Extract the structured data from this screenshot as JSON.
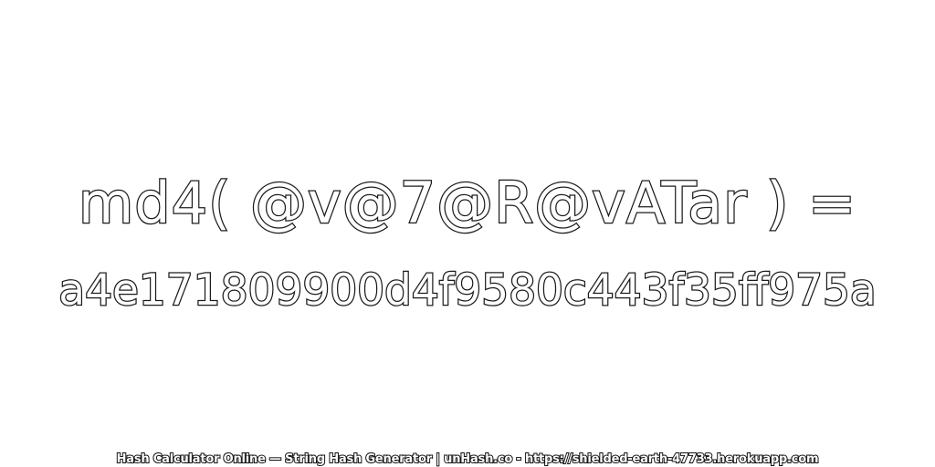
{
  "expression": "md4( @v@7@R@vATar ) =",
  "hash": "a4e171809900d4f9580c443f35ff975a",
  "footer": "Hash Calculator Online — String Hash Generator | unHash.co - https://shielded-earth-47733.herokuapp.com",
  "colors": {
    "background": "#ffffff",
    "text_fill": "#ffffff",
    "text_outline": "#1a1a1a"
  }
}
